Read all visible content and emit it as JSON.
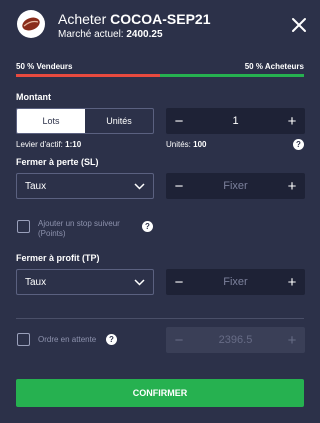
{
  "header": {
    "action": "Acheter",
    "instrument": "COCOA-SEP21",
    "market_label": "Marché actuel:",
    "market_price": "2400.25",
    "logo_icon": "cocoa-bean-icon",
    "close_icon": "close-icon"
  },
  "sentiment": {
    "sellers": "50 % Vendeurs",
    "buyers": "50 % Acheteurs",
    "sellers_pct": 50,
    "buyers_pct": 50,
    "sell_color": "#e84a3f",
    "buy_color": "#26b150"
  },
  "amount": {
    "label": "Montant",
    "tab_lots": "Lots",
    "tab_units": "Unités",
    "selected_tab": "Lots",
    "quantity": "1",
    "minus": "−",
    "plus": "+",
    "leverage_label": "Levier d'actif:",
    "leverage_value": "1:10",
    "units_label": "Unités:",
    "units_value": "100"
  },
  "stop_loss": {
    "label": "Fermer à perte (SL)",
    "select_value": "Taux",
    "placeholder": "Fixer",
    "minus": "−",
    "plus": "+"
  },
  "trailing_stop": {
    "label_line1": "Ajouter un stop suiveur",
    "label_line2": "(Points)"
  },
  "take_profit": {
    "label": "Fermer à profit (TP)",
    "select_value": "Taux",
    "placeholder": "Fixer",
    "minus": "−",
    "plus": "+"
  },
  "pending_order": {
    "label": "Ordre en attente",
    "price": "2396.5",
    "minus": "−",
    "plus": "+"
  },
  "confirm_label": "CONFIRMER",
  "help_glyph": "?",
  "colors": {
    "background": "#2c3149",
    "input_bg": "#1e2236",
    "confirm": "#26b150"
  }
}
